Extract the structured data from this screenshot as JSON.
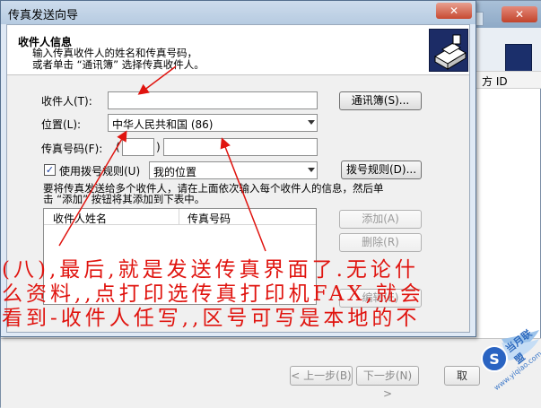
{
  "background_window": {
    "column_header": "方 ID",
    "close_glyph": "✕",
    "buttons": {
      "back": "< 上一步(B)",
      "next": "下一步(N) >",
      "cancel": "取"
    }
  },
  "dialog": {
    "title": "传真发送向导",
    "close_glyph": "✕",
    "header": {
      "title": "收件人信息",
      "line1": "输入传真收件人的姓名和传真号码，",
      "line2": "或者单击 “通讯簿” 选择传真收件人。"
    },
    "fields": {
      "recipient_label": "收件人(T):",
      "recipient_value": "",
      "address_book_button": "通讯簿(S)...",
      "location_label": "位置(L):",
      "location_value": "中华人民共和国 (86)",
      "fax_number_label": "传真号码(F):",
      "area_code_open": "(",
      "area_code_close": ")",
      "area_code_value": "",
      "fax_number_value": "",
      "use_dialing_rules_label": "使用拨号规则(U)",
      "use_dialing_rules_checked": "✓",
      "dialing_location_value": "我的位置",
      "dialing_rules_button": "拨号规则(D)..."
    },
    "instructions": {
      "line1": "要将传真发送给多个收件人，请在上面依次输入每个收件人的信息，然后单",
      "line2": "击 “添加” 按钮将其添加到下表中。"
    },
    "recipient_table": {
      "columns": [
        "收件人姓名",
        "传真号码"
      ]
    },
    "list_buttons": {
      "add": "添加(A)",
      "remove": "删除(R)",
      "edit": "编辑(E)"
    }
  },
  "annotation": {
    "line1": "(八),最后,就是发送传真界面了.无论什",
    "line2": "么资料,,点打印选传真打印机FAX,就会",
    "line3": "看到-收件人任写,,区号可写是本地的不",
    "color": "#e0140f"
  },
  "watermark": {
    "logo_letter": "S",
    "name": "当月联盟",
    "site": "www.yiqiao.com"
  }
}
